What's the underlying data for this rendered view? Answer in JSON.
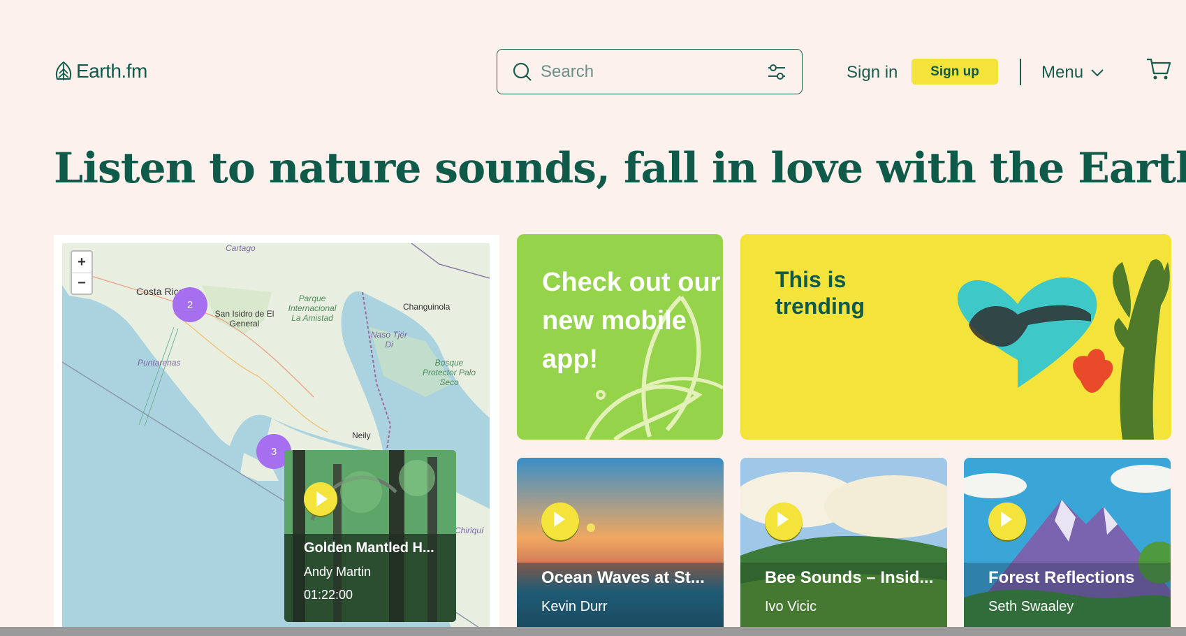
{
  "brand": {
    "name": "Earth.fm"
  },
  "search": {
    "placeholder": "Search"
  },
  "nav": {
    "signin": "Sign in",
    "signup": "Sign up",
    "menu": "Menu"
  },
  "hero": {
    "headline": "Listen to nature sounds, fall in love with the Earth"
  },
  "map": {
    "zoom_in": "+",
    "zoom_out": "−",
    "clusters": [
      "2",
      "3"
    ],
    "labels": {
      "cartago": "Cartago",
      "costa_rica": "Costa Rica",
      "san_isidro": "San Isidro de El General",
      "parque": "Parque Internacional La Amistad",
      "changuinola": "Changuinola",
      "naso": "Naso Tjër Di",
      "bosque": "Bosque Protector Palo Seco",
      "puntarenas": "Puntarenas",
      "neily": "Neily",
      "chiriqui": "Chiriquí"
    },
    "popup": {
      "title": "Golden Mantled H...",
      "artist": "Andy Martin",
      "duration": "01:22:00"
    }
  },
  "promos": {
    "app": "Check out our new mobile app!",
    "trending": "This is trending"
  },
  "cards": [
    {
      "title": "Ocean Waves at St...",
      "artist": "Kevin Durr"
    },
    {
      "title": "Bee Sounds – Insid...",
      "artist": "Ivo Vicic"
    },
    {
      "title": "Forest Reflections",
      "artist": "Seth Swaaley"
    }
  ],
  "colors": {
    "primary": "#0f5a48",
    "background": "#fdf1ee",
    "accent_yellow": "#f3e33b",
    "accent_green": "#94d34a",
    "cluster": "#a56ff0"
  }
}
